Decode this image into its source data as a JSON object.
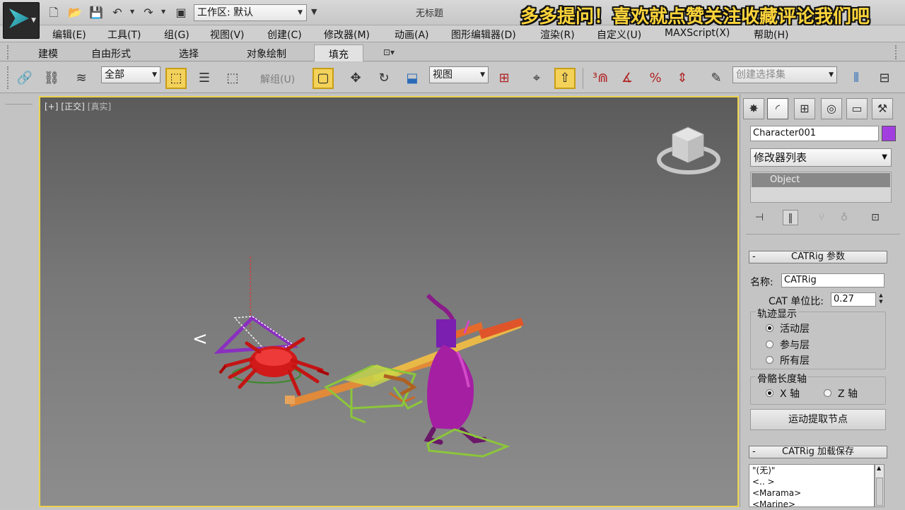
{
  "titlebar": {
    "workspace_label": "工作区: 默认",
    "doc_title": "无标题",
    "banner": "多多提问！喜欢就点赞关注收藏评论我们吧"
  },
  "menubar": {
    "items": [
      "编辑(E)",
      "工具(T)",
      "组(G)",
      "视图(V)",
      "创建(C)",
      "修改器(M)",
      "动画(A)",
      "图形编辑器(D)",
      "渲染(R)",
      "自定义(U)",
      "MAXScript(X)",
      "帮助(H)"
    ]
  },
  "ribbon": {
    "tabs": [
      "建模",
      "自由形式",
      "选择",
      "对象绘制",
      "填充"
    ],
    "active": "填充"
  },
  "toolbar": {
    "filter_value": "全部",
    "ungroup_label": "解组(U)",
    "ref_coord_value": "视图",
    "selection_set_placeholder": "创建选择集"
  },
  "viewport": {
    "label_plus": "[+]",
    "label_view": "[正交]",
    "label_shading": "[真实]"
  },
  "command_panel": {
    "object_name": "Character001",
    "object_color": "#a23ee0",
    "modifier_list": "修改器列表",
    "stack_item": "Object",
    "rollout_catrig": "CATRig 参数",
    "name_label": "名称:",
    "name_value": "CATRig",
    "unit_label": "CAT 单位比:",
    "unit_value": "0.27",
    "trajectory_title": "轨迹显示",
    "trajectory_options": [
      "活动层",
      "参与层",
      "所有层"
    ],
    "trajectory_selected": 0,
    "bone_axis_title": "骨骼长度轴",
    "bone_axis_options": [
      "X 轴",
      "Z 轴"
    ],
    "bone_axis_selected": 0,
    "extract_button": "运动提取节点",
    "rollout_preset": "CATRig 加载保存",
    "preset_items": [
      "\"(无)\"",
      "<.. >",
      "<Marama>",
      "<Marine>"
    ]
  }
}
